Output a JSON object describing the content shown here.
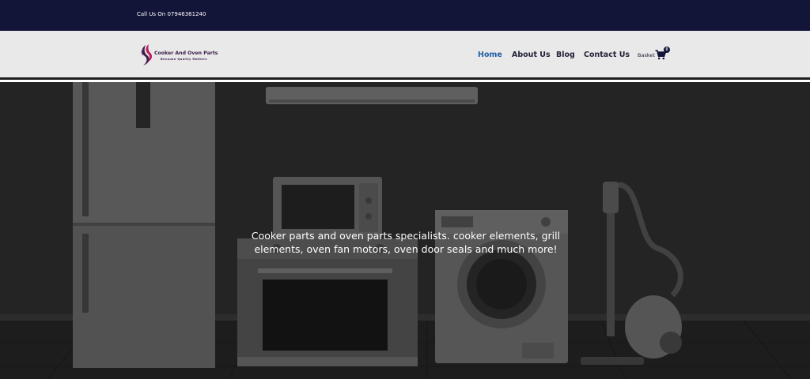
{
  "topbar": {
    "phone_text": "Call Us On 07946361240"
  },
  "logo": {
    "name": "Cooker And Oven Parts",
    "tagline": "Because Quality Matters"
  },
  "nav": {
    "items": [
      {
        "label": "Home",
        "active": true
      },
      {
        "label": "About Us",
        "active": false
      },
      {
        "label": "Blog",
        "active": false
      },
      {
        "label": "Contact Us",
        "active": false
      }
    ]
  },
  "basket": {
    "label": "Basket",
    "count": "0",
    "icon": "cart-icon"
  },
  "hero": {
    "text": "Cooker parts and oven parts specialists. cooker elements, grill elements, oven fan motors, oven door seals and much more!"
  },
  "colors": {
    "topbar_bg": "#121438",
    "header_bg": "#e9e9e9",
    "nav_active": "#1f5fa8",
    "nav_text": "#222238",
    "logo_purple": "#3b1e4a",
    "logo_pink": "#c2185b"
  }
}
